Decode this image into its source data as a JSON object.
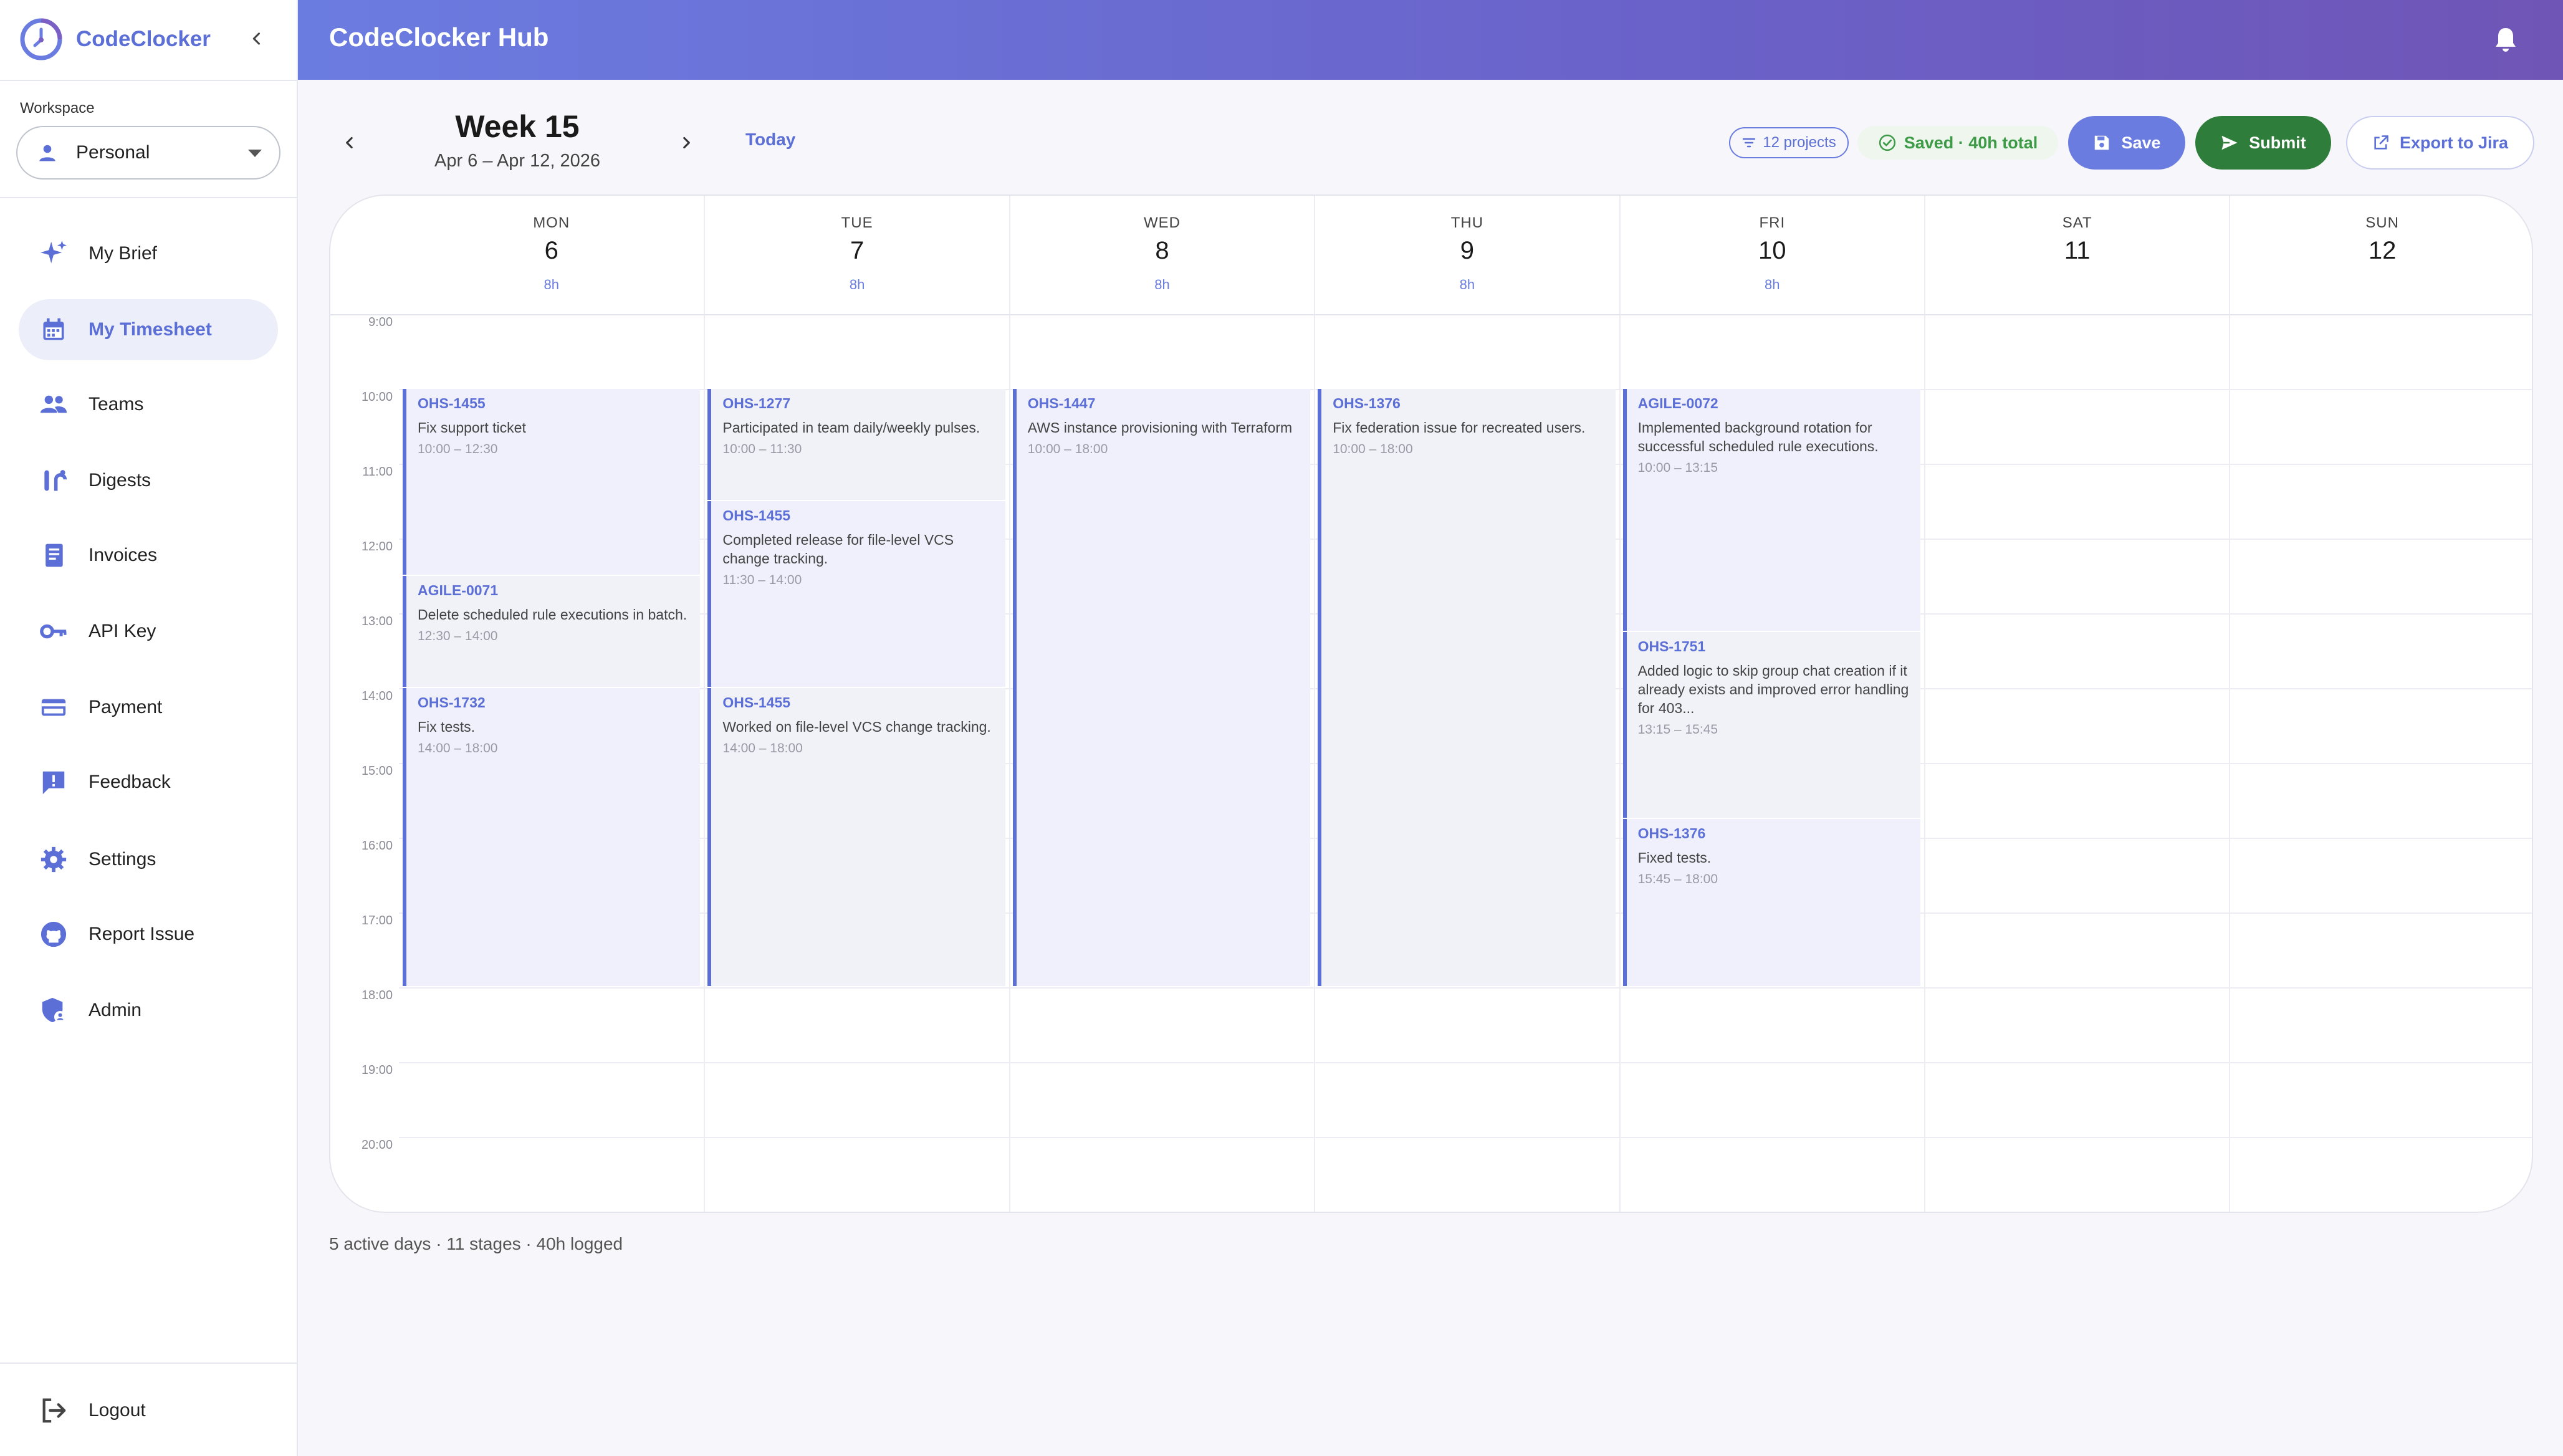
{
  "brand": {
    "name": "CodeClocker"
  },
  "workspace": {
    "label": "Workspace",
    "value": "Personal"
  },
  "sidebar": {
    "items": [
      {
        "label": "My Brief",
        "icon": "sparkle-icon"
      },
      {
        "label": "My Timesheet",
        "icon": "calendar-icon",
        "active": true
      },
      {
        "label": "Teams",
        "icon": "people-icon"
      },
      {
        "label": "Digests",
        "icon": "digest-icon"
      },
      {
        "label": "Invoices",
        "icon": "invoice-icon"
      },
      {
        "label": "API Key",
        "icon": "key-icon"
      },
      {
        "label": "Payment",
        "icon": "card-icon"
      },
      {
        "label": "Feedback",
        "icon": "feedback-icon"
      },
      {
        "label": "Settings",
        "icon": "gear-icon"
      },
      {
        "label": "Report Issue",
        "icon": "github-icon"
      },
      {
        "label": "Admin",
        "icon": "admin-shield-icon"
      }
    ],
    "logout": "Logout"
  },
  "header": {
    "title": "CodeClocker Hub"
  },
  "toolbar": {
    "week_title": "Week 15",
    "week_range": "Apr 6 – Apr 12, 2026",
    "today": "Today",
    "projects": "12 projects",
    "saved": "Saved · 40h total",
    "save": "Save",
    "submit": "Submit",
    "export": "Export to Jira"
  },
  "calendar": {
    "days": [
      {
        "name": "MON",
        "num": "6",
        "hours": "8h"
      },
      {
        "name": "TUE",
        "num": "7",
        "hours": "8h"
      },
      {
        "name": "WED",
        "num": "8",
        "hours": "8h"
      },
      {
        "name": "THU",
        "num": "9",
        "hours": "8h"
      },
      {
        "name": "FRI",
        "num": "10",
        "hours": "8h"
      },
      {
        "name": "SAT",
        "num": "11",
        "hours": ""
      },
      {
        "name": "SUN",
        "num": "12",
        "hours": ""
      }
    ],
    "hours": [
      "9:00",
      "10:00",
      "11:00",
      "12:00",
      "13:00",
      "14:00",
      "15:00",
      "16:00",
      "17:00",
      "18:00",
      "19:00",
      "20:00"
    ],
    "events": [
      {
        "day": 0,
        "code": "OHS-1455",
        "desc": "Fix support ticket",
        "time": "10:00 – 12:30",
        "start": 10,
        "end": 12.5
      },
      {
        "day": 0,
        "code": "AGILE-0071",
        "desc": "Delete scheduled rule executions in batch.",
        "time": "12:30 – 14:00",
        "start": 12.5,
        "end": 14
      },
      {
        "day": 0,
        "code": "OHS-1732",
        "desc": "Fix tests.",
        "time": "14:00 – 18:00",
        "start": 14,
        "end": 18
      },
      {
        "day": 1,
        "code": "OHS-1277",
        "desc": "Participated in team daily/weekly pulses.",
        "time": "10:00 – 11:30",
        "start": 10,
        "end": 11.5
      },
      {
        "day": 1,
        "code": "OHS-1455",
        "desc": "Completed release for file-level VCS change tracking.",
        "time": "11:30 – 14:00",
        "start": 11.5,
        "end": 14
      },
      {
        "day": 1,
        "code": "OHS-1455",
        "desc": "Worked on file-level VCS change tracking.",
        "time": "14:00 – 18:00",
        "start": 14,
        "end": 18
      },
      {
        "day": 2,
        "code": "OHS-1447",
        "desc": "AWS instance provisioning with Terraform",
        "time": "10:00 – 18:00",
        "start": 10,
        "end": 18
      },
      {
        "day": 3,
        "code": "OHS-1376",
        "desc": "Fix federation issue for recreated users.",
        "time": "10:00 – 18:00",
        "start": 10,
        "end": 18
      },
      {
        "day": 4,
        "code": "AGILE-0072",
        "desc": "Implemented background rotation for successful scheduled rule executions.",
        "time": "10:00 – 13:15",
        "start": 10,
        "end": 13.25
      },
      {
        "day": 4,
        "code": "OHS-1751",
        "desc": "Added logic to skip group chat creation if it already exists and improved error handling for 403...",
        "time": "13:15 – 15:45",
        "start": 13.25,
        "end": 15.75
      },
      {
        "day": 4,
        "code": "OHS-1376",
        "desc": "Fixed tests.",
        "time": "15:45 – 18:00",
        "start": 15.75,
        "end": 18
      }
    ]
  },
  "summary": "5 active days · 11 stages · 40h logged",
  "colors": {
    "accent": "#5b6fd6",
    "submit": "#2f7d3a",
    "saved": "#3d9b47"
  }
}
